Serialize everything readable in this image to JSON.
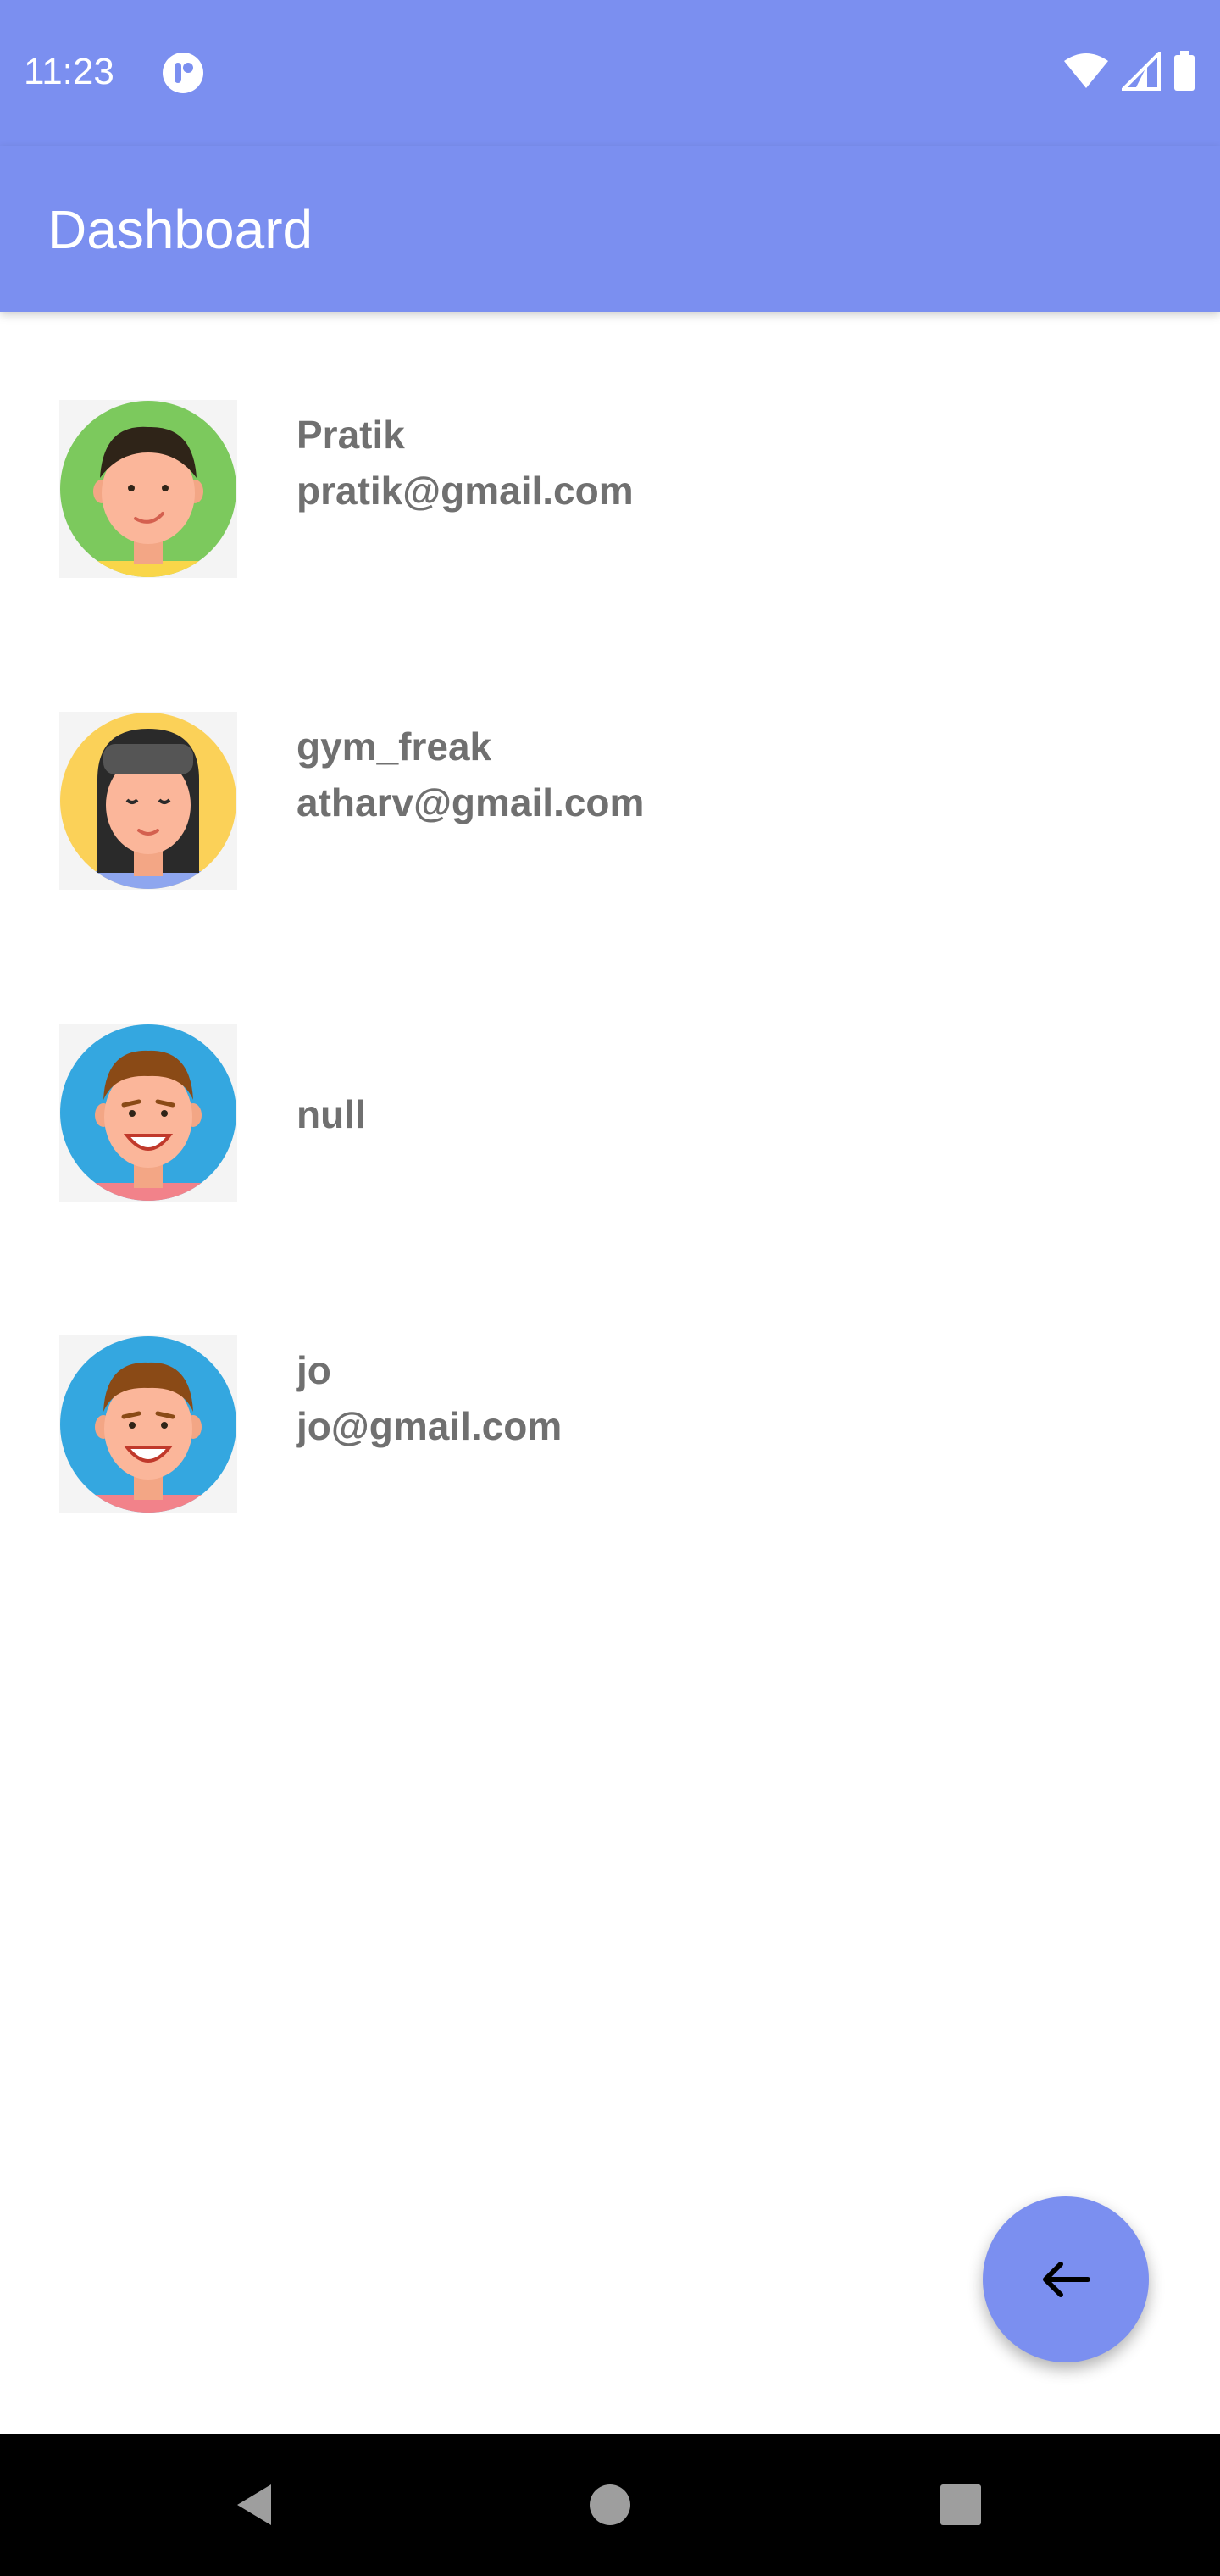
{
  "status_bar": {
    "time": "11:23",
    "icons": [
      "app-notification-icon",
      "wifi-icon",
      "cellular-signal-icon",
      "battery-icon"
    ]
  },
  "app_bar": {
    "title": "Dashboard",
    "color": "#7b8ff0"
  },
  "users": [
    {
      "name": "Pratik",
      "email": "pratik@gmail.com",
      "avatar": "male-avatar-green"
    },
    {
      "name": "gym_freak",
      "email": "atharv@gmail.com",
      "avatar": "female-avatar-yellow"
    },
    {
      "name": "null",
      "email": "",
      "avatar": "male-avatar-blue"
    },
    {
      "name": "jo",
      "email": "jo@gmail.com",
      "avatar": "male-avatar-blue"
    }
  ],
  "fab": {
    "icon": "arrow-back-icon",
    "color": "#7b8ff0"
  },
  "nav_bar": {
    "icons": [
      "back-triangle-icon",
      "home-circle-icon",
      "recents-square-icon"
    ]
  }
}
